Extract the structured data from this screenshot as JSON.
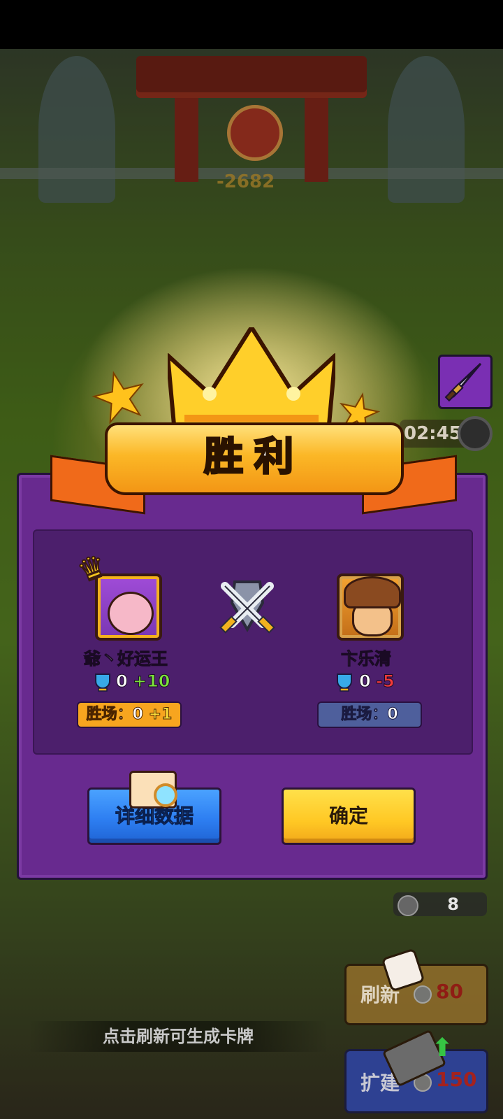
{
  "background": {
    "score_ghost": "-2682",
    "timer": "02:45",
    "coins": "8"
  },
  "result": {
    "title": "胜利"
  },
  "players": [
    {
      "name": "爺丶好运王",
      "trophies": "0",
      "trophy_delta": "+10",
      "wins_label": "胜场：",
      "wins": "0",
      "wins_delta": "+1"
    },
    {
      "name": "卞乐清",
      "trophies": "0",
      "trophy_delta": "-5",
      "wins_label": "胜场：",
      "wins": "0"
    }
  ],
  "buttons": {
    "detail": "详细数据",
    "confirm": "确定"
  },
  "footer": {
    "hint": "点击刷新可生成卡牌",
    "refresh_label": "刷新",
    "refresh_cost": "80",
    "build_label": "扩建",
    "build_cost": "150"
  },
  "colors": {
    "panel": "#682a8f",
    "banner": "#fbb726",
    "detail_button": "#2e7ff2",
    "confirm_button": "#ffc824",
    "gain": "#7be23a",
    "loss": "#f03a3a"
  }
}
